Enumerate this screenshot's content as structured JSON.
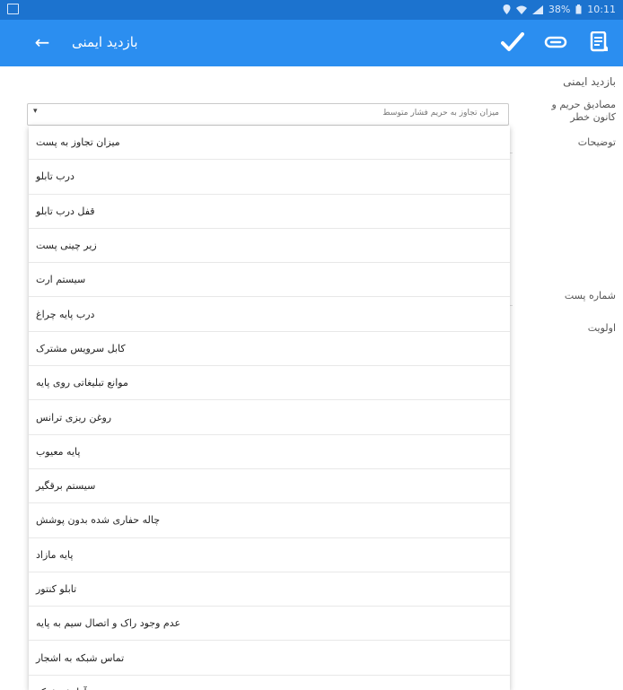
{
  "status_bar": {
    "battery_text": "38%",
    "time": "10:11"
  },
  "app_bar": {
    "title": "بازدید ایمنی",
    "back_icon": "arrow-back-icon",
    "actions": [
      {
        "icon": "check-icon"
      },
      {
        "icon": "attachment-icon"
      },
      {
        "icon": "form-icon"
      }
    ]
  },
  "form": {
    "section_title": "بازدید ایمنی",
    "field_category_label": "مصادیق حریم و کانون خطر",
    "field_description_label": "توضیحات",
    "field_post_number_label": "شماره پست",
    "field_priority_label": "اولویت",
    "select_value": "میزان تجاوز به حریم فشار متوسط"
  },
  "dropdown": {
    "items": [
      "میزان تجاوز به پست",
      "درب تابلو",
      "قفل درب تابلو",
      "زیر چینی پست",
      "سیستم ارت",
      "درب پایه چراغ",
      "کابل سرویس مشترک",
      "موانع تبلیغاتی روی پایه",
      "روغن ریزی ترانس",
      "پایه معیوب",
      "سیستم برقگیر",
      "چاله حفاری شده بدون پوشش",
      "پایه مازاد",
      "تابلو کنتور",
      "عدم وجود راک و اتصال سیم به پایه",
      "تماس شبکه به اشجار",
      "آرایش شبکه"
    ]
  },
  "colors": {
    "status_bar": "#1c73cf",
    "app_bar": "#2b8ef0"
  }
}
